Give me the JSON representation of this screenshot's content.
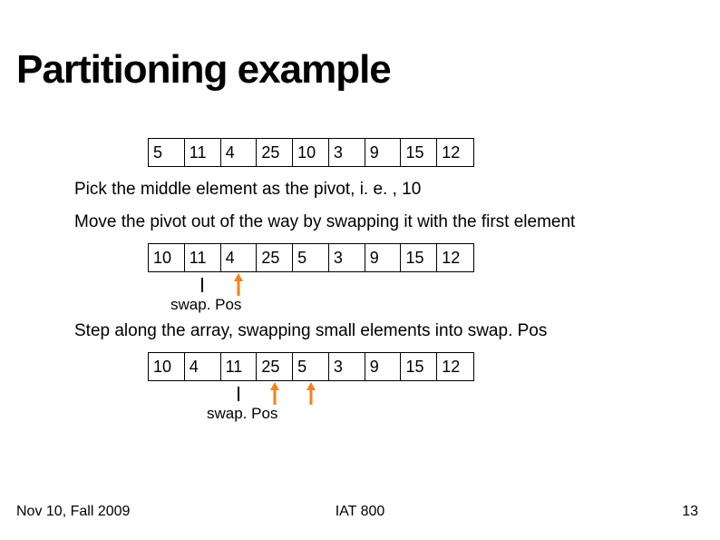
{
  "title": "Partitioning example",
  "arrays": {
    "a1": [
      "5",
      "11",
      "4",
      "25",
      "10",
      "3",
      "9",
      "15",
      "12"
    ],
    "a2": [
      "10",
      "11",
      "4",
      "25",
      "5",
      "3",
      "9",
      "15",
      "12"
    ],
    "a3": [
      "10",
      "4",
      "11",
      "25",
      "5",
      "3",
      "9",
      "15",
      "12"
    ]
  },
  "text": {
    "line1": "Pick the middle element as the pivot, i. e. , 10",
    "line2": "Move the pivot out of the way by swapping it with the first element",
    "line3": "Step along the array, swapping small elements into swap. Pos",
    "swapPos": "swap. Pos"
  },
  "footer": {
    "left": "Nov 10, Fall 2009",
    "center": "IAT 800",
    "right": "13"
  },
  "colors": {
    "accent": "#F58220"
  }
}
